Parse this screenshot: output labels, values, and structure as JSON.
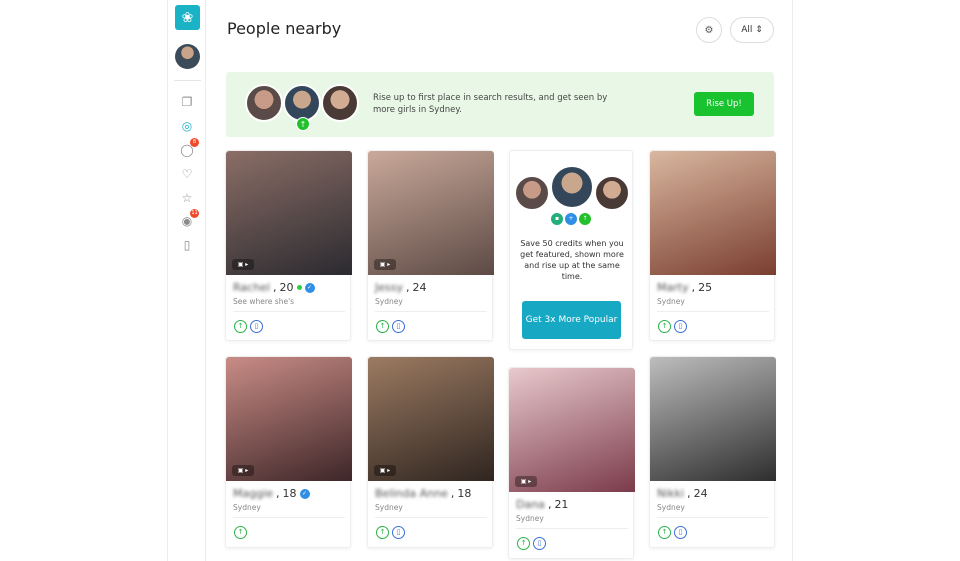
{
  "header": {
    "title": "People nearby",
    "filter_value": "All"
  },
  "sidebar": {
    "items": [
      {
        "icon": "cards-icon",
        "badge": ""
      },
      {
        "icon": "globe-icon",
        "badge": ""
      },
      {
        "icon": "chat-icon",
        "badge": "8"
      },
      {
        "icon": "heart-icon",
        "badge": ""
      },
      {
        "icon": "star-icon",
        "badge": ""
      },
      {
        "icon": "eye-icon",
        "badge": "11"
      },
      {
        "icon": "phone-icon",
        "badge": ""
      }
    ]
  },
  "banner": {
    "text": "Rise up to first place in search results, and get seen by more girls in Sydney.",
    "button": "Rise Up!"
  },
  "promo": {
    "text": "Save 50 credits when you get featured, shown more and rise up at the same time.",
    "button": "Get 3x More Popular"
  },
  "profiles": [
    {
      "name": "Rachel",
      "age": "20",
      "online": true,
      "verified": true,
      "sub": "See where she's",
      "colors": [
        "#8b6e66",
        "#2b2a30"
      ]
    },
    {
      "name": "Jessy",
      "age": "24",
      "online": false,
      "verified": false,
      "sub": "Sydney",
      "colors": [
        "#c9a99a",
        "#5d4a45"
      ]
    },
    {
      "name": "Marty",
      "age": "25",
      "online": false,
      "verified": false,
      "sub": "Sydney",
      "colors": [
        "#d9b79f",
        "#7a3e2f"
      ]
    },
    {
      "name": "Maggie",
      "age": "18",
      "online": false,
      "verified": true,
      "sub": "Sydney",
      "colors": [
        "#c98c86",
        "#3e2628"
      ]
    },
    {
      "name": "Belinda Anne",
      "age": "18",
      "online": false,
      "verified": false,
      "sub": "Sydney",
      "colors": [
        "#9c7b62",
        "#2f2520"
      ]
    },
    {
      "name": "Dana",
      "age": "21",
      "online": false,
      "verified": false,
      "sub": "Sydney",
      "colors": [
        "#e8c9cc",
        "#7b3b4a"
      ]
    },
    {
      "name": "Nikki",
      "age": "24",
      "online": false,
      "verified": false,
      "sub": "Sydney",
      "colors": [
        "#bdbdbd",
        "#2e2e2e"
      ]
    }
  ]
}
